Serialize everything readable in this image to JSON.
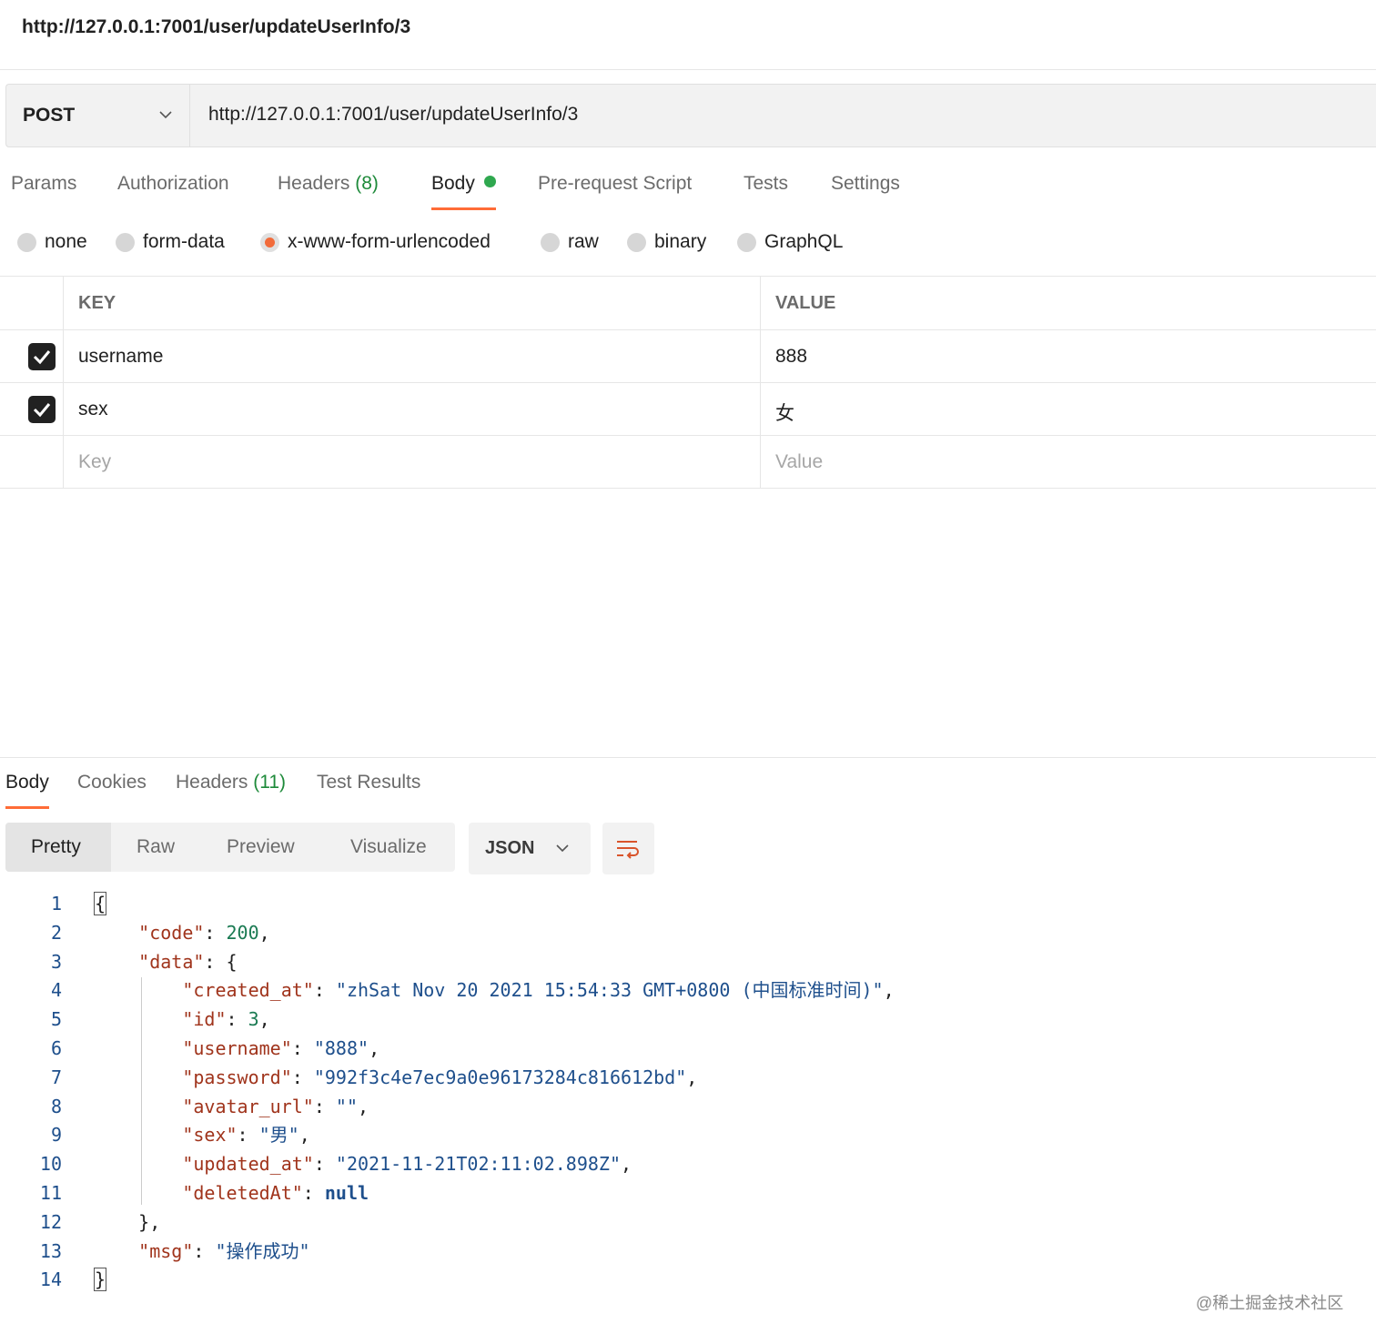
{
  "page_title": "http://127.0.0.1:7001/user/updateUserInfo/3",
  "request": {
    "method": "POST",
    "url": "http://127.0.0.1:7001/user/updateUserInfo/3"
  },
  "request_tabs": {
    "params": "Params",
    "authorization": "Authorization",
    "headers": "Headers",
    "headers_count": "(8)",
    "body": "Body",
    "pre_request": "Pre-request Script",
    "tests": "Tests",
    "settings": "Settings"
  },
  "body_modes": {
    "none": "none",
    "form_data": "form-data",
    "urlencoded": "x-www-form-urlencoded",
    "raw": "raw",
    "binary": "binary",
    "graphql": "GraphQL",
    "selected": "x-www-form-urlencoded"
  },
  "kv_table": {
    "key_header": "KEY",
    "value_header": "VALUE",
    "rows": [
      {
        "key": "username",
        "value": "888",
        "checked": true
      },
      {
        "key": "sex",
        "value": "女",
        "checked": true
      }
    ],
    "key_placeholder": "Key",
    "value_placeholder": "Value"
  },
  "response_tabs": {
    "body": "Body",
    "cookies": "Cookies",
    "headers": "Headers",
    "headers_count": "(11)",
    "test_results": "Test Results"
  },
  "view_modes": {
    "pretty": "Pretty",
    "raw": "Raw",
    "preview": "Preview",
    "visualize": "Visualize"
  },
  "format": "JSON",
  "response_json": {
    "brace_open": "{",
    "brace_close": "}",
    "code_key": "\"code\"",
    "code_val": "200",
    "data_key": "\"data\"",
    "created_key": "\"created_at\"",
    "created_val": "\"zhSat Nov 20 2021 15:54:33 GMT+0800 (中国标准时间)\"",
    "id_key": "\"id\"",
    "id_val": "3",
    "username_key": "\"username\"",
    "username_val": "\"888\"",
    "password_key": "\"password\"",
    "password_val": "\"992f3c4e7ec9a0e96173284c816612bd\"",
    "avatar_key": "\"avatar_url\"",
    "avatar_val": "\"\"",
    "sex_key": "\"sex\"",
    "sex_val": "\"男\"",
    "updated_key": "\"updated_at\"",
    "updated_val": "\"2021-11-21T02:11:02.898Z\"",
    "deleted_key": "\"deletedAt\"",
    "deleted_val": "null",
    "data_close": "},",
    "msg_key": "\"msg\"",
    "msg_val": "\"操作成功\""
  },
  "line_numbers": [
    "1",
    "2",
    "3",
    "4",
    "5",
    "6",
    "7",
    "8",
    "9",
    "10",
    "11",
    "12",
    "13",
    "14"
  ],
  "watermark": "@稀土掘金技术社区",
  "colors": {
    "accent": "#ff6c37",
    "body_dot": "#2fa84f",
    "count_green": "#1e8a3a"
  }
}
